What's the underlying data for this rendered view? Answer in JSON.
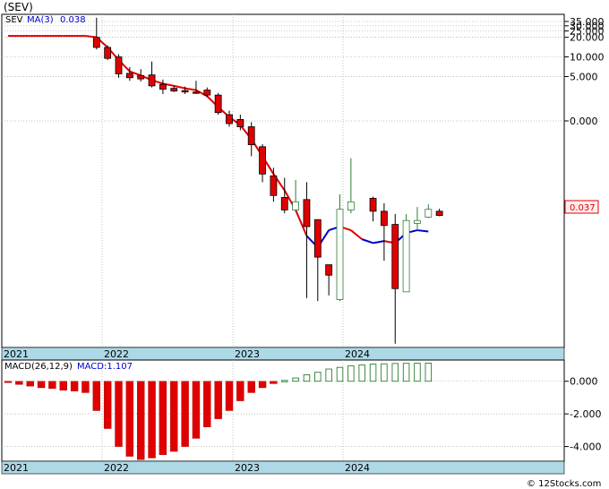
{
  "title": "(SEV)",
  "legend": {
    "symbol": "SEV",
    "ma_label": "MA(3)",
    "ma_value": "0.038"
  },
  "last_price_tag": "0.037",
  "macd_legend": {
    "label": "MACD(26,12,9)",
    "value_label": "MACD:1.107"
  },
  "watermark": "© 12Stocks.com",
  "colors": {
    "up": "#2e7d32",
    "down": "#e00000",
    "ma_up": "#0000cc",
    "ma_down": "#e00000",
    "axis_band": "#add8e6",
    "macd_pos": "#2e7d32",
    "macd_neg": "#e00000"
  },
  "chart_data": [
    {
      "type": "candlestick",
      "title": "(SEV)",
      "y_scale": "log",
      "y_ticks": [
        "35.000",
        "30.000",
        "25.000",
        "20.000",
        "10.000",
        "5.000",
        "0.000"
      ],
      "x_labels": [
        "2021",
        "2022",
        "2023",
        "2024"
      ],
      "ma_series": [
        21,
        21,
        21,
        21,
        21,
        21,
        21,
        21,
        20,
        14,
        9,
        6,
        5.2,
        4.4,
        3.9,
        3.6,
        3.3,
        3.1,
        2.5,
        1.7,
        1.2,
        0.9,
        0.55,
        0.3,
        0.16,
        0.09,
        0.045,
        0.018,
        0.012,
        0.022,
        0.025,
        0.022,
        0.016,
        0.014,
        0.015,
        0.014,
        0.02,
        0.022,
        0.021
      ],
      "ma_color_by_bar": [
        "down",
        "down",
        "down",
        "down",
        "down",
        "down",
        "down",
        "down",
        "down",
        "down",
        "down",
        "down",
        "down",
        "down",
        "down",
        "down",
        "down",
        "down",
        "down",
        "down",
        "down",
        "down",
        "down",
        "down",
        "down",
        "down",
        "down",
        "down",
        "up",
        "up",
        "up",
        "down",
        "down",
        "up",
        "up",
        "down",
        "up",
        "up",
        "up"
      ],
      "candles": [
        {
          "i": 8,
          "open": 20,
          "close": 14,
          "high": 40,
          "low": 13
        },
        {
          "i": 9,
          "open": 14,
          "close": 9.5,
          "high": 15,
          "low": 9
        },
        {
          "i": 10,
          "open": 10,
          "close": 5.5,
          "high": 11,
          "low": 4.8
        },
        {
          "i": 11,
          "open": 5.6,
          "close": 4.8,
          "high": 7,
          "low": 4.3
        },
        {
          "i": 12,
          "open": 5.2,
          "close": 4.6,
          "high": 6.5,
          "low": 4.2
        },
        {
          "i": 13,
          "open": 5.3,
          "close": 3.6,
          "high": 8.5,
          "low": 3.4
        },
        {
          "i": 14,
          "open": 3.8,
          "close": 3.2,
          "high": 4.5,
          "low": 2.7
        },
        {
          "i": 15,
          "open": 3.3,
          "close": 3.0,
          "high": 3.6,
          "low": 2.9
        },
        {
          "i": 16,
          "open": 3.05,
          "close": 2.9,
          "high": 3.5,
          "low": 2.7
        },
        {
          "i": 17,
          "open": 2.9,
          "close": 2.8,
          "high": 4.3,
          "low": 2.7
        },
        {
          "i": 18,
          "open": 3.1,
          "close": 2.6,
          "high": 3.4,
          "low": 2.4
        },
        {
          "i": 19,
          "open": 2.6,
          "close": 1.4,
          "high": 2.8,
          "low": 1.3
        },
        {
          "i": 20,
          "open": 1.3,
          "close": 0.95,
          "high": 1.5,
          "low": 0.85
        },
        {
          "i": 21,
          "open": 1.1,
          "close": 0.85,
          "high": 1.3,
          "low": 0.75
        },
        {
          "i": 22,
          "open": 0.85,
          "close": 0.45,
          "high": 1.0,
          "low": 0.3
        },
        {
          "i": 23,
          "open": 0.42,
          "close": 0.16,
          "high": 0.46,
          "low": 0.12
        },
        {
          "i": 24,
          "open": 0.15,
          "close": 0.075,
          "high": 0.2,
          "low": 0.06
        },
        {
          "i": 25,
          "open": 0.07,
          "close": 0.045,
          "high": 0.14,
          "low": 0.04
        },
        {
          "i": 26,
          "open": 0.045,
          "close": 0.06,
          "high": 0.13,
          "low": 0.042
        },
        {
          "i": 27,
          "open": 0.065,
          "close": 0.025,
          "high": 0.12,
          "low": 0.002
        },
        {
          "i": 28,
          "open": 0.032,
          "close": 0.0085,
          "high": 0.032,
          "low": 0.0018
        },
        {
          "i": 29,
          "open": 0.0065,
          "close": 0.0045,
          "high": 0.0065,
          "low": 0.0022
        },
        {
          "i": 30,
          "open": 0.0019,
          "close": 0.046,
          "high": 0.078,
          "low": 0.0018
        },
        {
          "i": 31,
          "open": 0.045,
          "close": 0.06,
          "high": 0.28,
          "low": 0.04
        },
        {
          "i": 33,
          "open": 0.068,
          "close": 0.043,
          "high": 0.072,
          "low": 0.03
        },
        {
          "i": 34,
          "open": 0.043,
          "close": 0.026,
          "high": 0.057,
          "low": 0.0075
        },
        {
          "i": 35,
          "open": 0.027,
          "close": 0.0028,
          "high": 0.039,
          "low": 0.0004
        },
        {
          "i": 36,
          "open": 0.0025,
          "close": 0.031,
          "high": 0.039,
          "low": 0.0025
        },
        {
          "i": 37,
          "open": 0.028,
          "close": 0.031,
          "high": 0.05,
          "low": 0.022
        },
        {
          "i": 38,
          "open": 0.035,
          "close": 0.046,
          "high": 0.055,
          "low": 0.034
        },
        {
          "i": 39,
          "open": 0.043,
          "close": 0.037,
          "high": 0.047,
          "low": 0.036
        }
      ]
    },
    {
      "type": "bar",
      "title": "MACD(26,12,9)",
      "y_ticks": [
        "0.000",
        "-2.000",
        "-4.000"
      ],
      "ylim": [
        -4.9,
        1.3
      ],
      "x_labels": [
        "2021",
        "2022",
        "2023",
        "2024"
      ],
      "values": [
        -0.08,
        -0.2,
        -0.3,
        -0.4,
        -0.45,
        -0.55,
        -0.6,
        -0.7,
        -1.8,
        -2.9,
        -4.0,
        -4.6,
        -4.8,
        -4.7,
        -4.5,
        -4.3,
        -4.0,
        -3.5,
        -2.8,
        -2.3,
        -1.8,
        -1.2,
        -0.7,
        -0.4,
        -0.15,
        0.05,
        0.2,
        0.4,
        0.55,
        0.75,
        0.85,
        0.95,
        1.0,
        1.05,
        1.07,
        1.09,
        1.1,
        1.105,
        1.107
      ]
    }
  ]
}
